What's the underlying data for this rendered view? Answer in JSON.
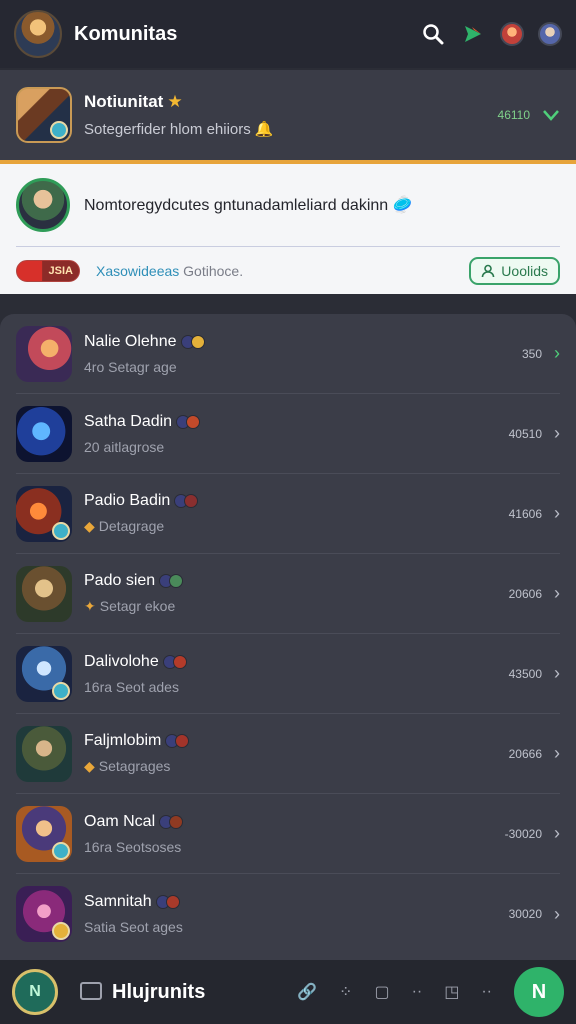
{
  "topbar": {
    "title": "Komunitas",
    "icons": [
      "search-icon",
      "send-icon"
    ],
    "accent": "#2fb36a"
  },
  "pinned": {
    "name": "Notiunitat",
    "star": "★",
    "subtitle": "Sotegerfider hlom ehiiors",
    "bell": "🔔",
    "time": "46110",
    "accent_color": "#e7a43b"
  },
  "message": {
    "text": "Nomtoregydcutes gntunadamleliard dakinn",
    "emoji": "🥏",
    "reaction": "JSIA",
    "link1": "Xasowideeas",
    "link2": "Gotihoce.",
    "follow_label": "Uoolids"
  },
  "list": [
    {
      "title": "Nalie Olehne",
      "subtitle": "4ro Setagr age",
      "meta": "350",
      "colors": [
        "#e4b13a",
        "#3a3f7a"
      ]
    },
    {
      "title": "Satha Dadin",
      "subtitle": "20 aitlagrose",
      "meta": "40510",
      "colors": [
        "#c24a2a",
        "#3a3f7a"
      ]
    },
    {
      "title": "Padio Badin",
      "subtitle": "Detagrage",
      "meta": "41606",
      "colors": [
        "#8a2f2f",
        "#3a3f7a"
      ]
    },
    {
      "title": "Pado sien",
      "subtitle": "Setagr ekoe",
      "meta": "20606",
      "colors": [
        "#4a8a5a",
        "#3a3f7a"
      ]
    },
    {
      "title": "Dalivolohe",
      "subtitle": "16ra Seot ades",
      "meta": "43500",
      "colors": [
        "#b33b2a",
        "#3a3f7a"
      ]
    },
    {
      "title": "Faljmlobim",
      "subtitle": "Setagrages",
      "meta": "20666",
      "colors": [
        "#a2342a",
        "#3a3f7a"
      ]
    },
    {
      "title": "Oam Ncal",
      "subtitle": "16ra Seotsoses",
      "meta": "-30020",
      "colors": [
        "#8f3a22",
        "#3a3f7a"
      ]
    },
    {
      "title": "Samnitah",
      "subtitle": "Satia Seot ages",
      "meta": "30020",
      "colors": [
        "#a83a2a",
        "#3a3f7a"
      ]
    }
  ],
  "bottom": {
    "home_label": "N",
    "label": "Hlujrunits",
    "fab_label": "N"
  }
}
